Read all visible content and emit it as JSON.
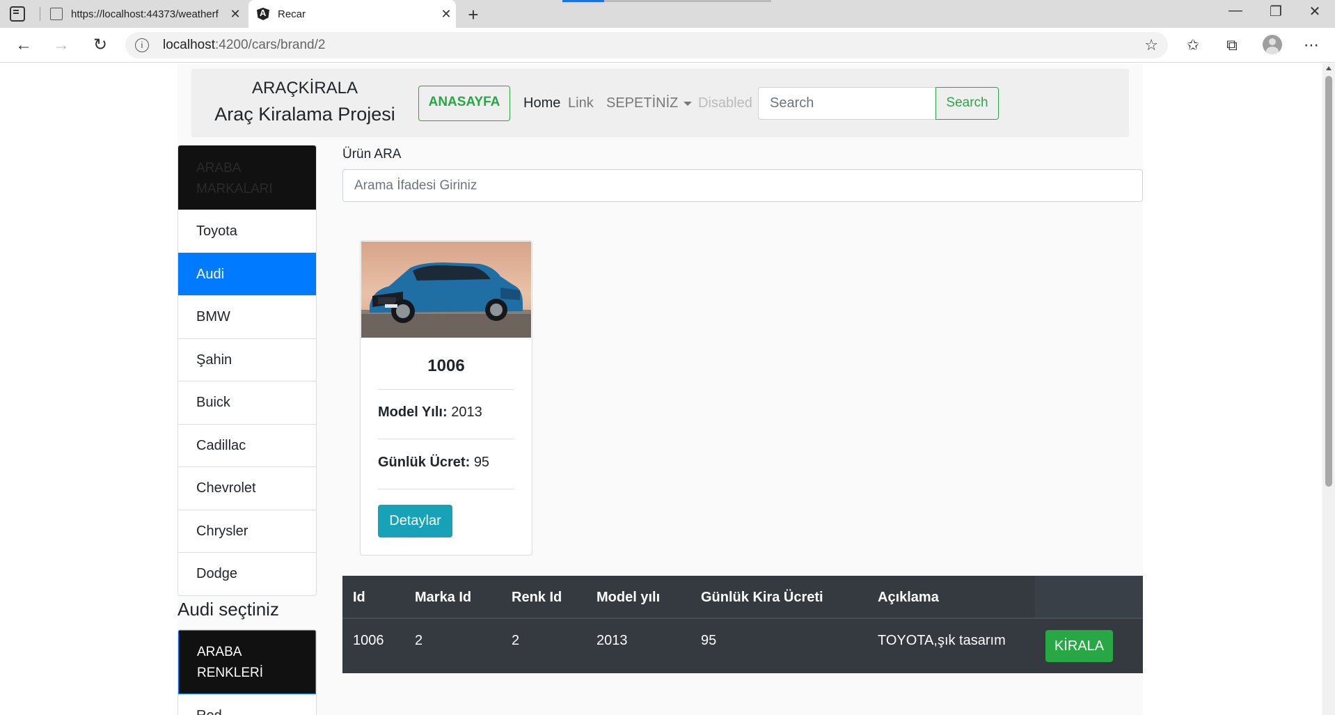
{
  "browser": {
    "tabs": [
      {
        "title": "https://localhost:44373/weatherf",
        "icon": "document-icon"
      },
      {
        "title": "Recar",
        "icon": "angular-icon"
      }
    ],
    "url_host": "localhost",
    "url_path": ":4200/cars/brand/2"
  },
  "navbar": {
    "brand_top": "ARAÇKİRALA",
    "brand_bottom": "Araç Kiralama Projesi",
    "home_button": "ANASAYFA",
    "links": [
      "Home",
      "Link",
      "SEPETİNİZ",
      "Disabled"
    ],
    "search_placeholder": "Search",
    "search_button": "Search"
  },
  "sidebar": {
    "brands_header": "ARABA MARKALARI",
    "brands": [
      "Toyota",
      "Audi",
      "BMW",
      "Şahin",
      "Buick",
      "Cadillac",
      "Chevrolet",
      "Chrysler",
      "Dodge"
    ],
    "active_brand": "Audi",
    "selected_text": "Audi seçtiniz",
    "colors_header": "ARABA RENKLERİ",
    "colors": [
      "Red"
    ]
  },
  "main": {
    "search_label": "Ürün ARA",
    "search_placeholder": "Arama İfadesi Giriniz",
    "card": {
      "title": "1006",
      "model_label": "Model Yılı:",
      "model_value": "2013",
      "price_label": "Günlük Ücret:",
      "price_value": "95",
      "details_button": "Detaylar"
    },
    "table": {
      "headers": [
        "Id",
        "Marka Id",
        "Renk Id",
        "Model yılı",
        "Günlük Kira Ücreti",
        "Açıklama",
        ""
      ],
      "rows": [
        {
          "id": "1006",
          "brand_id": "2",
          "color_id": "2",
          "model_year": "2013",
          "daily_price": "95",
          "description": "TOYOTA,şık tasarım",
          "action": "KİRALA"
        }
      ]
    }
  },
  "colors": {
    "primary": "#007bff",
    "success": "#28a745",
    "info": "#17a2b8",
    "dark": "#343a40"
  }
}
